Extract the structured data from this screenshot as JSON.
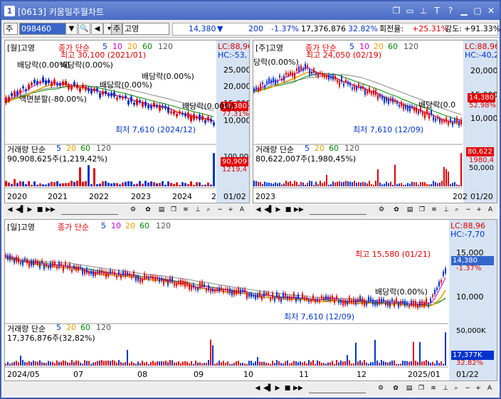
{
  "window": {
    "number": "1",
    "title": "[0613] 키움일주월차트"
  },
  "titlebar_icons": [
    "restore-icon",
    "window-icon",
    "pin-icon",
    "text-icon",
    "help-icon",
    "minimize-icon",
    "maximize-icon",
    "close-icon"
  ],
  "toolbar": {
    "market": "주",
    "code": "098460",
    "name_prefix": "주",
    "name": "고영",
    "price": "14,380",
    "arrow": "▼",
    "change": "200",
    "change_rate": "-1.37%",
    "volume": "17,376,876",
    "volume_rate": "32.82%",
    "turnover_label": "회전율:",
    "turnover": "+25.31%",
    "strength_label": "강도:",
    "strength": "+91.33%"
  },
  "monthly": {
    "header": "[월]고영",
    "ma_label": "종가 단순",
    "ma": [
      "5",
      "10",
      "20",
      "60",
      "120"
    ],
    "lc": "LC:88,96",
    "hc": "HC:-53,",
    "axis": [
      "25,000",
      "20,000",
      "15,000",
      "10,000"
    ],
    "price_tag": "14,380",
    "rate_tag": "77.31%",
    "annotations": {
      "high": "최고 30,100 (2021/01)",
      "dividend1": "배당락(0.00%)",
      "dividend2": "배당락(0.00%)",
      "dividend3": "배당락(0.00%)",
      "dividend4": "배당락(0.00%)",
      "dividend5": "배당락(0.00%)",
      "split": "액면분할(-80.00%)",
      "low": "최저 7,610 (2024/12)"
    },
    "vol_header": "거래량 단순",
    "vol_ma": [
      "5",
      "20",
      "60",
      "120"
    ],
    "vol_value": "90,908,625주(1,219,42%)",
    "vol_axis": "100,000",
    "vol_tag": "90,909",
    "vol_rate": "1219,4",
    "dates": [
      "2020",
      "2021",
      "2022",
      "2023",
      "2024",
      "2",
      "01/02"
    ]
  },
  "weekly": {
    "header": "[주]고영",
    "ma_label": "종가 단순",
    "ma": [
      "5",
      "10",
      "20",
      "60",
      "120"
    ],
    "lc": "LC:88,96",
    "hc": "HC:-40,2",
    "axis": [
      "20,000",
      "15,000",
      "10,000"
    ],
    "price_tag": "14,380",
    "rate_tag": "52.98%",
    "annotations": {
      "high": "최고 24,050 (02/19)",
      "dividend1": "당락(0.00%)",
      "dividend2": "배당락(0.0",
      "low": "최저 7,610 (12/09)"
    },
    "vol_header": "거래량 단순",
    "vol_ma": [
      "5",
      "20",
      "60",
      "120"
    ],
    "vol_value": "80,622,007주(1,980,45%)",
    "vol_axis": "50,000",
    "vol_tag": "80,622",
    "vol_rate": "1980,4",
    "dates": [
      "2023",
      "202",
      "01/20"
    ]
  },
  "daily": {
    "header": "[일]고영",
    "ma_label": "종가 단순",
    "ma": [
      "5",
      "10",
      "20",
      "60",
      "120"
    ],
    "lc": "LC:88,96",
    "hc": "HC:-7,70",
    "axis": [
      "15,000",
      "10,000"
    ],
    "price_tag": "14,380",
    "rate_tag": "-1.37%",
    "annotations": {
      "high": "최고 15,580 (01/21)",
      "dividend": "배당락(0.00%)",
      "low": "최저 7,610 (12/09)"
    },
    "vol_header": "거래량 단순",
    "vol_ma": [
      "5",
      "20",
      "60",
      "120"
    ],
    "vol_value": "17,376,876주(32,82%)",
    "vol_axis": "50,000K",
    "vol_tag": "17,377K",
    "vol_rate": "32.82%",
    "dates": [
      "2024/05",
      "07",
      "08",
      "09",
      "10",
      "11",
      "12",
      "2025/01",
      "01/22"
    ]
  },
  "colors": {
    "up": "#e00000",
    "down": "#0033cc",
    "ma5": "#cc00cc",
    "ma20": "#e8a000",
    "ma60": "#008800",
    "ma120": "#888888",
    "axis_panel": "#d6e3f3"
  }
}
